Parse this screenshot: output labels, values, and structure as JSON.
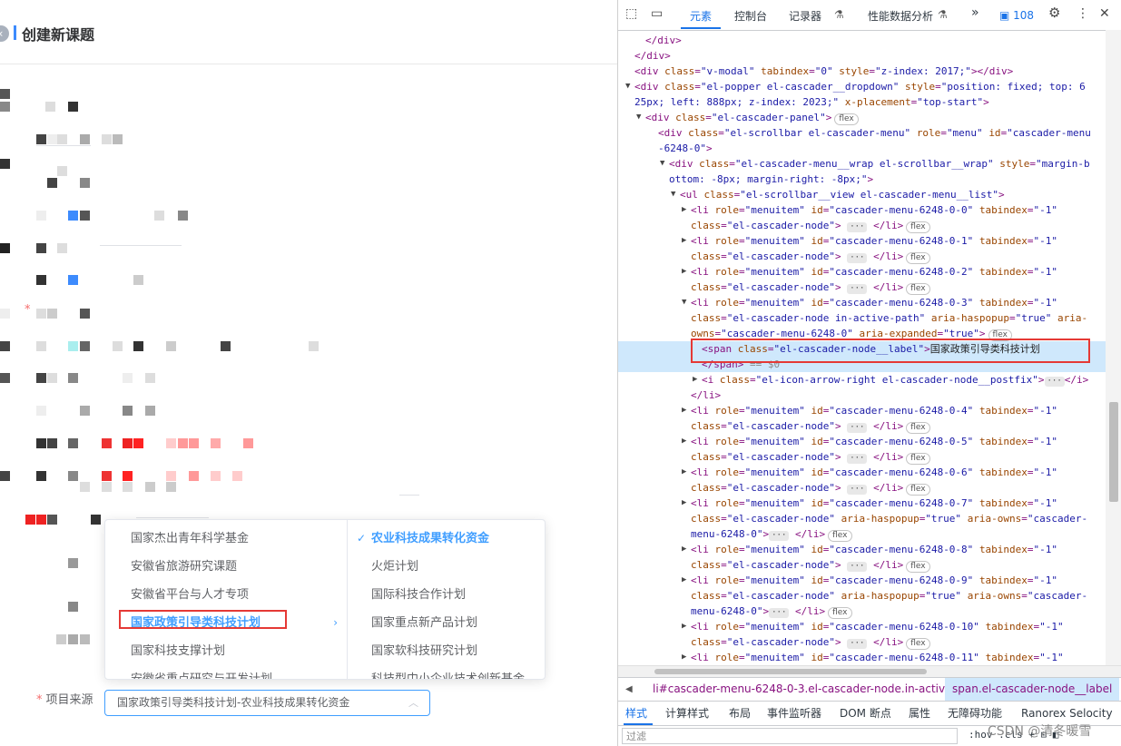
{
  "app": {
    "title": "创建新课题",
    "back_icon": "‹",
    "cascader": {
      "left_menu": [
        {
          "label": "国家杰出青年科学基金"
        },
        {
          "label": "安徽省旅游研究课题"
        },
        {
          "label": "安徽省平台与人才专项"
        },
        {
          "label": "国家政策引导类科技计划",
          "active": true
        },
        {
          "label": "国家科技支撑计划"
        },
        {
          "label": "安徽省重点研究与开发计划"
        }
      ],
      "right_menu": [
        {
          "label": "农业科技成果转化资金",
          "active": true
        },
        {
          "label": "火炬计划"
        },
        {
          "label": "国际科技合作计划"
        },
        {
          "label": "国家重点新产品计划"
        },
        {
          "label": "国家软科技研究计划"
        },
        {
          "label": "科技型中小企业技术创新基金"
        }
      ],
      "arrow": "›",
      "check": "✓"
    },
    "source_field": {
      "label": "项目来源",
      "required": "*",
      "value": "国家政策引导类科技计划-农业科技成果转化资金",
      "caret": "︿"
    }
  },
  "devtools": {
    "toolbar": {
      "tabs": [
        "元素",
        "控制台",
        "记录器",
        "性能数据分析"
      ],
      "active_tab": "元素",
      "more": "»",
      "issues_count": "108",
      "recorder_icon": "⚗",
      "perf_icon": "⚗",
      "gear": "⚙",
      "kebab": "⋮",
      "close": "✕",
      "inspect_icon": "⬚",
      "device_icon": "▭"
    },
    "dom_lines": [
      {
        "indent": 30,
        "html": "<span class='t'>&lt;/div&gt;</span>"
      },
      {
        "indent": 18,
        "html": "<span class='t'>&lt;/div&gt;</span>"
      },
      {
        "indent": 18,
        "html": "<span class='t'>&lt;div</span> <span class='a'>class</span><span class='p'>=</span><span class='v'>\"v-modal\"</span> <span class='a'>tabindex</span><span class='p'>=</span><span class='v'>\"0\"</span> <span class='a'>style</span><span class='p'>=</span><span class='v'>\"z-index: 2017;\"</span><span class='t'>&gt;&lt;/div&gt;</span>"
      },
      {
        "indent": 18,
        "tw": "▼",
        "html": "<span class='t'>&lt;div</span> <span class='a'>class</span><span class='p'>=</span><span class='v'>\"el-popper el-cascader__dropdown\"</span> <span class='a'>style</span><span class='p'>=</span><span class='v'>\"position: fixed; top: 6</span>"
      },
      {
        "indent": 18,
        "html": "<span class='v'>25px; left: 888px; z-index: 2023;\"</span> <span class='a'>x-placement</span><span class='p'>=</span><span class='v'>\"top-start\"</span><span class='t'>&gt;</span>"
      },
      {
        "indent": 30,
        "tw": "▼",
        "html": "<span class='t'>&lt;div</span> <span class='a'>class</span><span class='p'>=</span><span class='v'>\"el-cascader-panel\"</span><span class='t'>&gt;</span><span class='badge'>flex</span>"
      },
      {
        "indent": 44,
        "html": "<span class='t'>&lt;div</span> <span class='a'>class</span><span class='p'>=</span><span class='v'>\"el-scrollbar el-cascader-menu\"</span> <span class='a'>role</span><span class='p'>=</span><span class='v'>\"menu\"</span> <span class='a'>id</span><span class='p'>=</span><span class='v'>\"cascader-menu</span>"
      },
      {
        "indent": 44,
        "html": "<span class='v'>-6248-0\"</span><span class='t'>&gt;</span>"
      },
      {
        "indent": 56,
        "tw": "▼",
        "html": "<span class='t'>&lt;div</span> <span class='a'>class</span><span class='p'>=</span><span class='v'>\"el-cascader-menu__wrap el-scrollbar__wrap\"</span> <span class='a'>style</span><span class='p'>=</span><span class='v'>\"margin-b</span>"
      },
      {
        "indent": 56,
        "html": "<span class='v'>ottom: -8px; margin-right: -8px;\"</span><span class='t'>&gt;</span>"
      },
      {
        "indent": 68,
        "tw": "▼",
        "html": "<span class='t'>&lt;ul</span> <span class='a'>class</span><span class='p'>=</span><span class='v'>\"el-scrollbar__view el-cascader-menu__list\"</span><span class='t'>&gt;</span>"
      },
      {
        "indent": 80,
        "tw": "▶",
        "html": "<span class='t'>&lt;li</span> <span class='a'>role</span><span class='p'>=</span><span class='v'>\"menuitem\"</span> <span class='a'>id</span><span class='p'>=</span><span class='v'>\"cascader-menu-6248-0-0\"</span> <span class='a'>tabindex</span><span class='p'>=</span><span class='v'>\"-1\"</span>"
      },
      {
        "indent": 80,
        "html": "<span class='a'>class</span><span class='p'>=</span><span class='v'>\"el-cascader-node\"</span><span class='t'>&gt;</span> <span class='ell'>···</span> <span class='t'>&lt;/li&gt;</span><span class='badge'>flex</span>"
      },
      {
        "indent": 80,
        "tw": "▶",
        "html": "<span class='t'>&lt;li</span> <span class='a'>role</span><span class='p'>=</span><span class='v'>\"menuitem\"</span> <span class='a'>id</span><span class='p'>=</span><span class='v'>\"cascader-menu-6248-0-1\"</span> <span class='a'>tabindex</span><span class='p'>=</span><span class='v'>\"-1\"</span>"
      },
      {
        "indent": 80,
        "html": "<span class='a'>class</span><span class='p'>=</span><span class='v'>\"el-cascader-node\"</span><span class='t'>&gt;</span> <span class='ell'>···</span> <span class='t'>&lt;/li&gt;</span><span class='badge'>flex</span>"
      },
      {
        "indent": 80,
        "tw": "▶",
        "html": "<span class='t'>&lt;li</span> <span class='a'>role</span><span class='p'>=</span><span class='v'>\"menuitem\"</span> <span class='a'>id</span><span class='p'>=</span><span class='v'>\"cascader-menu-6248-0-2\"</span> <span class='a'>tabindex</span><span class='p'>=</span><span class='v'>\"-1\"</span>"
      },
      {
        "indent": 80,
        "html": "<span class='a'>class</span><span class='p'>=</span><span class='v'>\"el-cascader-node\"</span><span class='t'>&gt;</span> <span class='ell'>···</span> <span class='t'>&lt;/li&gt;</span><span class='badge'>flex</span>"
      },
      {
        "indent": 80,
        "tw": "▼",
        "html": "<span class='t'>&lt;li</span> <span class='a'>role</span><span class='p'>=</span><span class='v'>\"menuitem\"</span> <span class='a'>id</span><span class='p'>=</span><span class='v'>\"cascader-menu-6248-0-3\"</span> <span class='a'>tabindex</span><span class='p'>=</span><span class='v'>\"-1\"</span>"
      },
      {
        "indent": 80,
        "html": "<span class='a'>class</span><span class='p'>=</span><span class='v'>\"el-cascader-node in-active-path\"</span> <span class='a'>aria-haspopup</span><span class='p'>=</span><span class='v'>\"true\"</span> <span class='a'>aria-</span>"
      },
      {
        "indent": 80,
        "html": "<span class='a'>owns</span><span class='p'>=</span><span class='v'>\"cascader-menu-6248-0\"</span> <span class='a'>aria-expanded</span><span class='p'>=</span><span class='v'>\"true\"</span><span class='t'>&gt;</span><span class='badge'>flex</span>"
      },
      {
        "indent": 92,
        "sel": true,
        "html": "<span class='t'>&lt;span</span> <span class='a'>class</span><span class='p'>=</span><span class='v'>\"el-cascader-node__label\"</span><span class='t'>&gt;</span><span class='plain'>国家政策引导类科技计划</span>"
      },
      {
        "indent": 92,
        "sel": true,
        "html": "<span class='t'>&lt;/span&gt;</span> <span class='dim'>== $0</span>"
      },
      {
        "indent": 92,
        "tw": "▶",
        "html": "<span class='t'>&lt;i</span> <span class='a'>class</span><span class='p'>=</span><span class='v'>\"el-icon-arrow-right el-cascader-node__postfix\"</span><span class='t'>&gt;</span><span class='ell'>···</span><span class='t'>&lt;/i&gt;</span>"
      },
      {
        "indent": 80,
        "html": "<span class='t'>&lt;/li&gt;</span>"
      },
      {
        "indent": 80,
        "tw": "▶",
        "html": "<span class='t'>&lt;li</span> <span class='a'>role</span><span class='p'>=</span><span class='v'>\"menuitem\"</span> <span class='a'>id</span><span class='p'>=</span><span class='v'>\"cascader-menu-6248-0-4\"</span> <span class='a'>tabindex</span><span class='p'>=</span><span class='v'>\"-1\"</span>"
      },
      {
        "indent": 80,
        "html": "<span class='a'>class</span><span class='p'>=</span><span class='v'>\"el-cascader-node\"</span><span class='t'>&gt;</span> <span class='ell'>···</span> <span class='t'>&lt;/li&gt;</span><span class='badge'>flex</span>"
      },
      {
        "indent": 80,
        "tw": "▶",
        "html": "<span class='t'>&lt;li</span> <span class='a'>role</span><span class='p'>=</span><span class='v'>\"menuitem\"</span> <span class='a'>id</span><span class='p'>=</span><span class='v'>\"cascader-menu-6248-0-5\"</span> <span class='a'>tabindex</span><span class='p'>=</span><span class='v'>\"-1\"</span>"
      },
      {
        "indent": 80,
        "html": "<span class='a'>class</span><span class='p'>=</span><span class='v'>\"el-cascader-node\"</span><span class='t'>&gt;</span> <span class='ell'>···</span> <span class='t'>&lt;/li&gt;</span><span class='badge'>flex</span>"
      },
      {
        "indent": 80,
        "tw": "▶",
        "html": "<span class='t'>&lt;li</span> <span class='a'>role</span><span class='p'>=</span><span class='v'>\"menuitem\"</span> <span class='a'>id</span><span class='p'>=</span><span class='v'>\"cascader-menu-6248-0-6\"</span> <span class='a'>tabindex</span><span class='p'>=</span><span class='v'>\"-1\"</span>"
      },
      {
        "indent": 80,
        "html": "<span class='a'>class</span><span class='p'>=</span><span class='v'>\"el-cascader-node\"</span><span class='t'>&gt;</span> <span class='ell'>···</span> <span class='t'>&lt;/li&gt;</span><span class='badge'>flex</span>"
      },
      {
        "indent": 80,
        "tw": "▶",
        "html": "<span class='t'>&lt;li</span> <span class='a'>role</span><span class='p'>=</span><span class='v'>\"menuitem\"</span> <span class='a'>id</span><span class='p'>=</span><span class='v'>\"cascader-menu-6248-0-7\"</span> <span class='a'>tabindex</span><span class='p'>=</span><span class='v'>\"-1\"</span>"
      },
      {
        "indent": 80,
        "html": "<span class='a'>class</span><span class='p'>=</span><span class='v'>\"el-cascader-node\"</span> <span class='a'>aria-haspopup</span><span class='p'>=</span><span class='v'>\"true\"</span> <span class='a'>aria-owns</span><span class='p'>=</span><span class='v'>\"cascader-</span>"
      },
      {
        "indent": 80,
        "html": "<span class='v'>menu-6248-0\"</span><span class='t'>&gt;</span><span class='ell'>···</span> <span class='t'>&lt;/li&gt;</span><span class='badge'>flex</span>"
      },
      {
        "indent": 80,
        "tw": "▶",
        "html": "<span class='t'>&lt;li</span> <span class='a'>role</span><span class='p'>=</span><span class='v'>\"menuitem\"</span> <span class='a'>id</span><span class='p'>=</span><span class='v'>\"cascader-menu-6248-0-8\"</span> <span class='a'>tabindex</span><span class='p'>=</span><span class='v'>\"-1\"</span>"
      },
      {
        "indent": 80,
        "html": "<span class='a'>class</span><span class='p'>=</span><span class='v'>\"el-cascader-node\"</span><span class='t'>&gt;</span> <span class='ell'>···</span> <span class='t'>&lt;/li&gt;</span><span class='badge'>flex</span>"
      },
      {
        "indent": 80,
        "tw": "▶",
        "html": "<span class='t'>&lt;li</span> <span class='a'>role</span><span class='p'>=</span><span class='v'>\"menuitem\"</span> <span class='a'>id</span><span class='p'>=</span><span class='v'>\"cascader-menu-6248-0-9\"</span> <span class='a'>tabindex</span><span class='p'>=</span><span class='v'>\"-1\"</span>"
      },
      {
        "indent": 80,
        "html": "<span class='a'>class</span><span class='p'>=</span><span class='v'>\"el-cascader-node\"</span> <span class='a'>aria-haspopup</span><span class='p'>=</span><span class='v'>\"true\"</span> <span class='a'>aria-owns</span><span class='p'>=</span><span class='v'>\"cascader-</span>"
      },
      {
        "indent": 80,
        "html": "<span class='v'>menu-6248-0\"</span><span class='t'>&gt;</span><span class='ell'>···</span> <span class='t'>&lt;/li&gt;</span><span class='badge'>flex</span>"
      },
      {
        "indent": 80,
        "tw": "▶",
        "html": "<span class='t'>&lt;li</span> <span class='a'>role</span><span class='p'>=</span><span class='v'>\"menuitem\"</span> <span class='a'>id</span><span class='p'>=</span><span class='v'>\"cascader-menu-6248-0-10\"</span> <span class='a'>tabindex</span><span class='p'>=</span><span class='v'>\"-1\"</span>"
      },
      {
        "indent": 80,
        "html": "<span class='a'>class</span><span class='p'>=</span><span class='v'>\"el-cascader-node\"</span><span class='t'>&gt;</span> <span class='ell'>···</span> <span class='t'>&lt;/li&gt;</span><span class='badge'>flex</span>"
      },
      {
        "indent": 80,
        "tw": "▶",
        "html": "<span class='t'>&lt;li</span> <span class='a'>role</span><span class='p'>=</span><span class='v'>\"menuitem\"</span> <span class='a'>id</span><span class='p'>=</span><span class='v'>\"cascader-menu-6248-0-11\"</span> <span class='a'>tabindex</span><span class='p'>=</span><span class='v'>\"-1\"</span>"
      }
    ],
    "breadcrumb": {
      "back": "◀",
      "forward": "▶",
      "item1": "li#cascader-menu-6248-0-3.el-cascader-node.in-active-path",
      "item2": "span.el-cascader-node__label"
    },
    "styles_tabs": [
      "样式",
      "计算样式",
      "布局",
      "事件监听器",
      "DOM 断点",
      "属性",
      "无障碍功能",
      "Ranorex Selocity"
    ],
    "filter_placeholder": "过滤",
    "hov_cls": ":hov .cls  +  ⊡  ◧"
  },
  "watermark": "CSDN @清冬暖雪"
}
